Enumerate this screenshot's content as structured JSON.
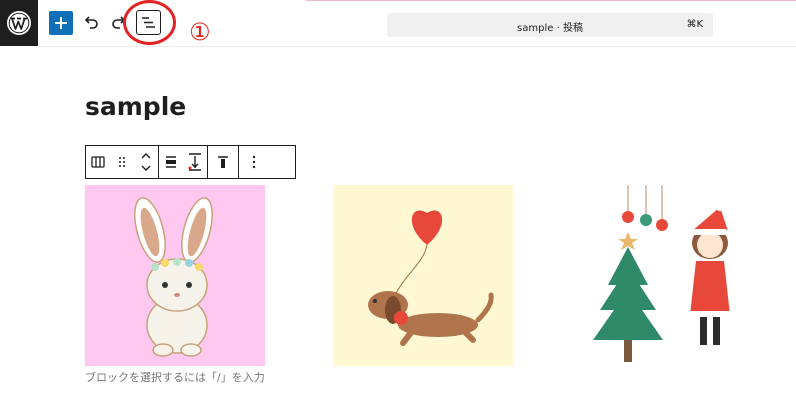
{
  "header": {
    "command_title": "sample · 投稿",
    "command_shortcut": "⌘K",
    "annotation_number": "①"
  },
  "icons": {
    "logo": "wordpress-icon",
    "add": "plus-icon",
    "undo": "undo-icon",
    "redo": "redo-icon",
    "list_view": "list-view-icon"
  },
  "post": {
    "title": "sample"
  },
  "block_toolbar": {
    "tools": [
      "columns-icon",
      "drag-handle-icon",
      "move-up-down-icon",
      "justify-icon",
      "height-icon",
      "align-top-icon",
      "more-options-icon"
    ]
  },
  "gallery": {
    "images": [
      "rabbit",
      "dachshund-with-heart-balloon",
      "christmas-tree-and-girl"
    ]
  },
  "placeholder": "ブロックを選択するには「/」を入力",
  "colors": {
    "accent": "#0f70b7",
    "annotation": "#e42222",
    "rabbit_bg": "#ffc8f1",
    "dog_bg": "#fff8d3"
  }
}
